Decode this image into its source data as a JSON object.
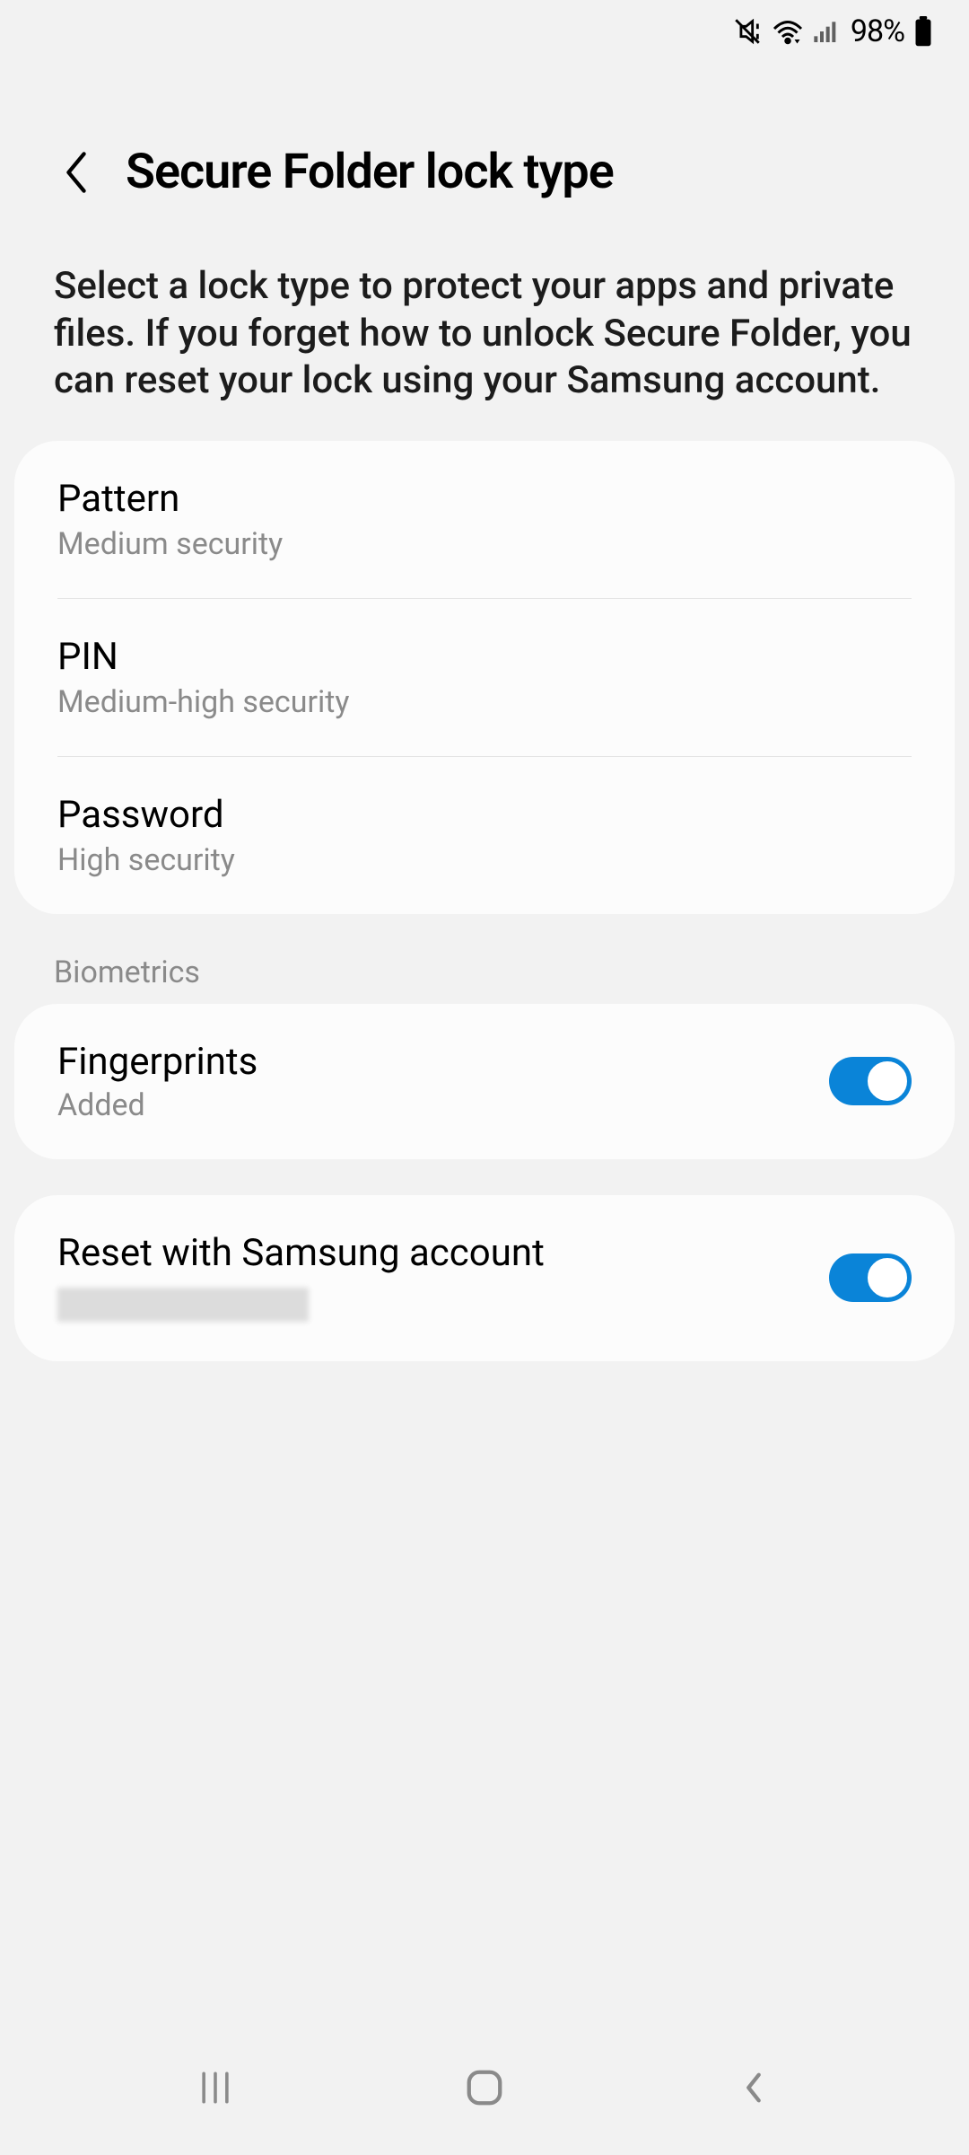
{
  "status": {
    "battery": "98%"
  },
  "header": {
    "title": "Secure Folder lock type"
  },
  "description": "Select a lock type to protect your apps and private files. If you forget how to unlock Secure Folder, you can reset your lock using your Samsung account.",
  "lock_types": [
    {
      "label": "Pattern",
      "sub": "Medium security"
    },
    {
      "label": "PIN",
      "sub": "Medium-high security"
    },
    {
      "label": "Password",
      "sub": "High security"
    }
  ],
  "section_biometrics": "Biometrics",
  "fingerprints": {
    "label": "Fingerprints",
    "sub": "Added",
    "on": true
  },
  "reset": {
    "label": "Reset with Samsung account",
    "on": true
  }
}
